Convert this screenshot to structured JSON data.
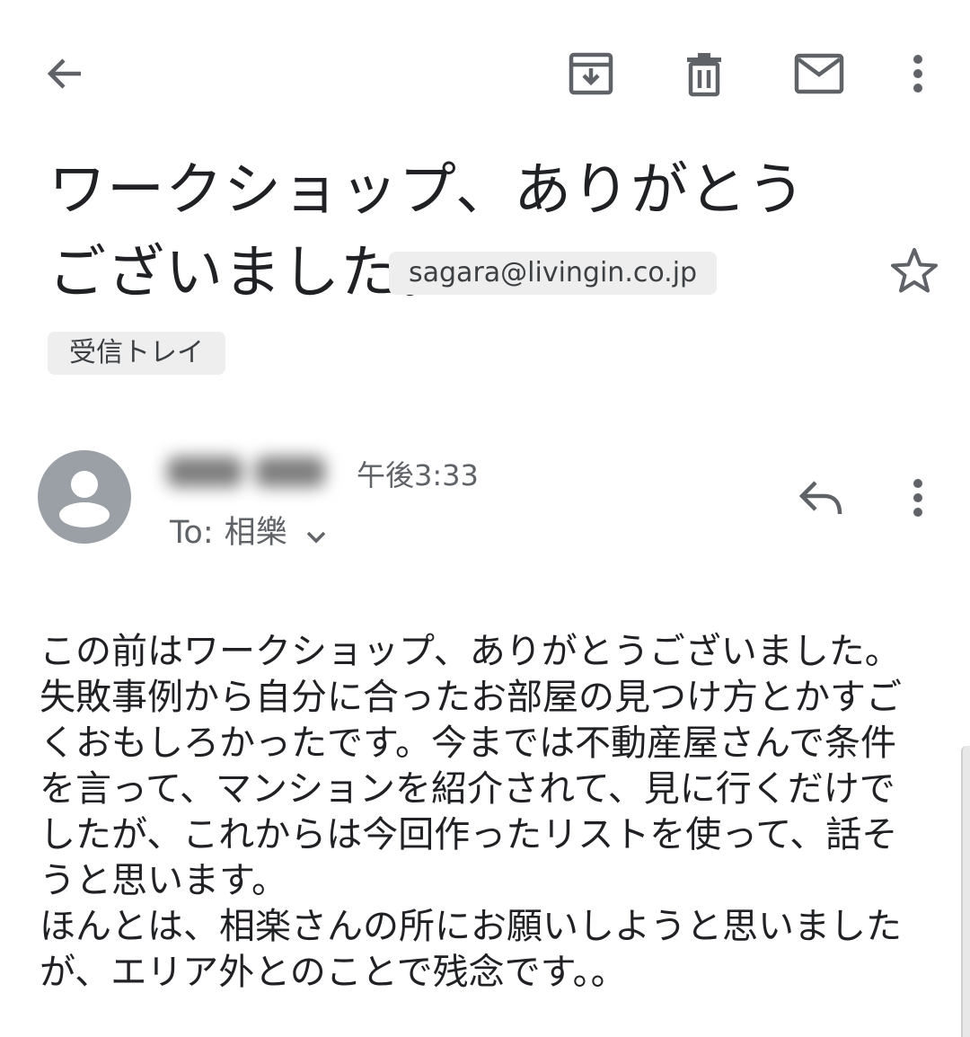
{
  "toolbar": {
    "back_icon": "arrow-left-icon",
    "archive_icon": "archive-icon",
    "delete_icon": "trash-icon",
    "mark_unread_icon": "envelope-icon",
    "more_icon": "more-vert-icon"
  },
  "message": {
    "subject": "ワークショップ、ありがとうございました。",
    "sender_email": "sagara@livingin.co.jp",
    "label": "受信トレイ",
    "time": "午後3:33",
    "to_prefix": "To:",
    "to_name": "相樂",
    "body": "この前はワークショップ、ありがとうございました。\n失敗事例から自分に合ったお部屋の見つけ方とかすご\nくおもしろかったです。今までは不動産屋さんで条件\nを言って、マンションを紹介されて、見に行くだけで\nしたが、これからは今回作ったリストを使って、話そ\nうと思います。\nほんとは、相楽さんの所にお願いしようと思いました\nが、エリア外とのことで残念です。。"
  },
  "colors": {
    "text_primary": "#202124",
    "text_secondary": "#5f6368",
    "chip_background": "#eeeeee",
    "icon_gray": "#5f6368",
    "avatar_background": "#9aa0a6"
  }
}
